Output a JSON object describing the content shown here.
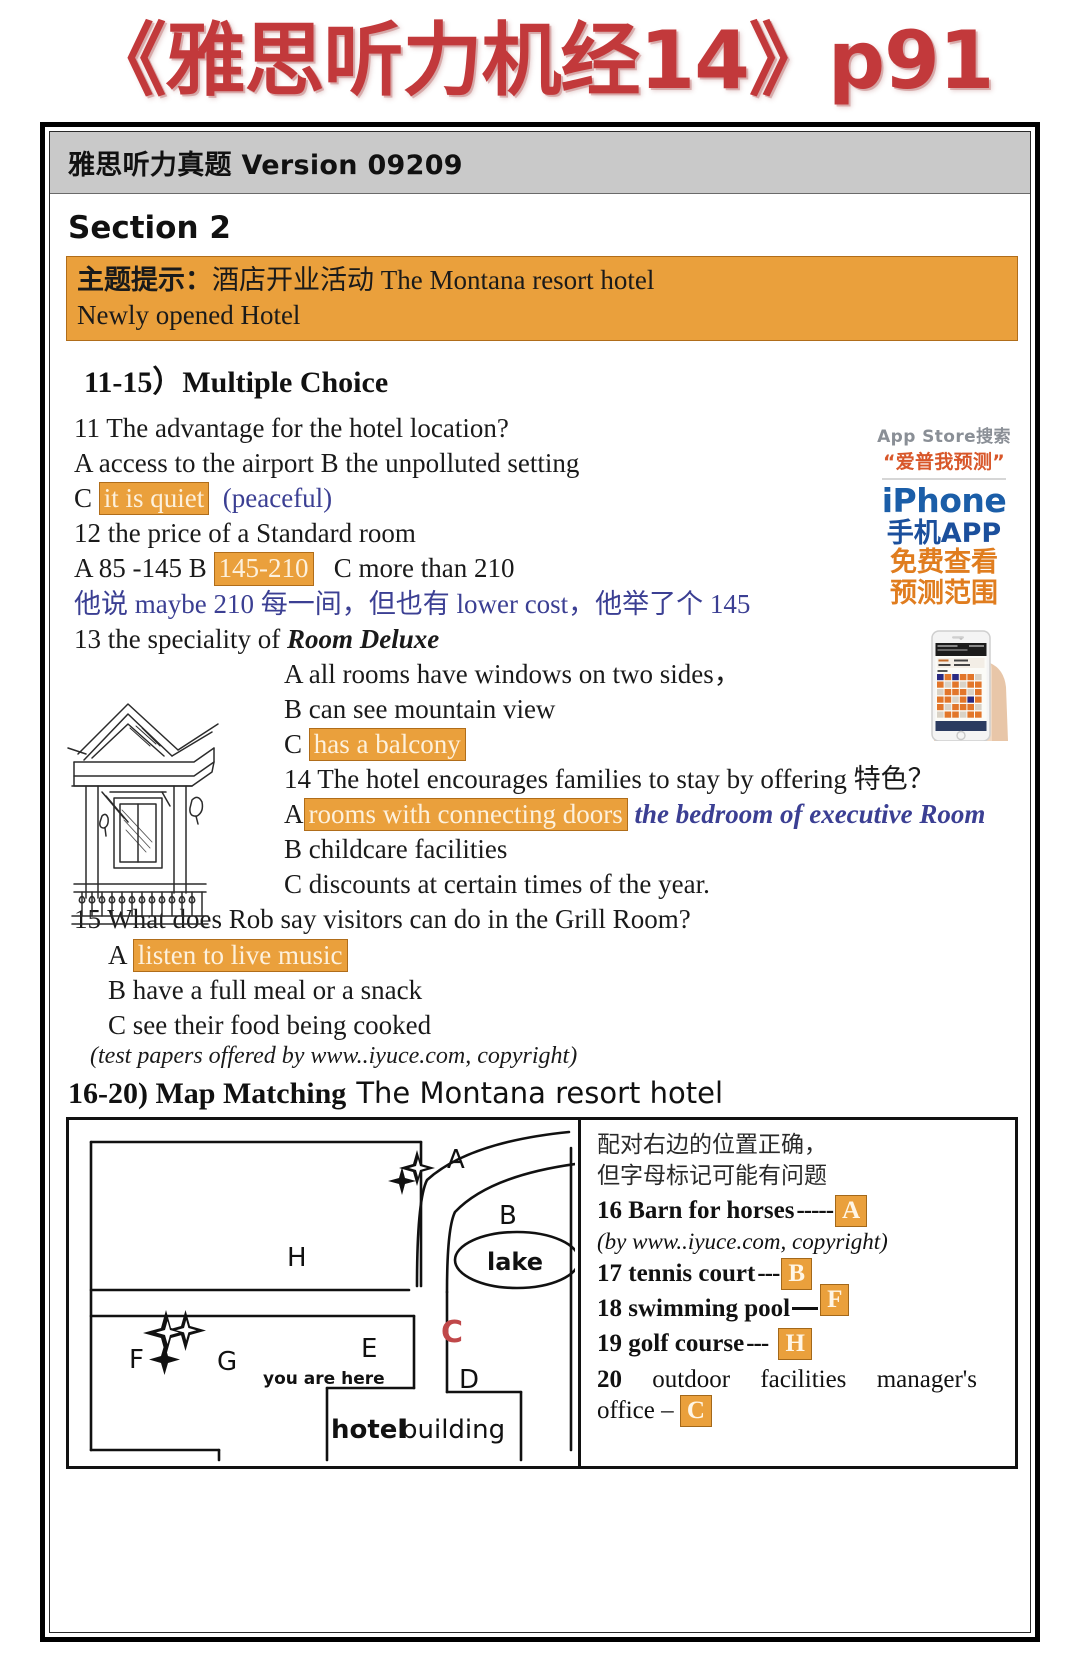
{
  "banner": {
    "title": "《雅思听力机经14》p91"
  },
  "version_bar": {
    "text": "雅思听力真题 Version 09209"
  },
  "section": {
    "title": "Section 2"
  },
  "topic_prompt": {
    "label": "主题提示：",
    "line1_rest": "酒店开业活动 The Montana resort hotel",
    "line2": "Newly opened Hotel"
  },
  "multiple_choice": {
    "heading": "11-15）Multiple Choice",
    "q11": {
      "stem": "11 The advantage for the hotel location?",
      "options_line": "A access to the airport B the unpolluted setting",
      "c_letter": "C",
      "c_highlight": "it is quiet",
      "c_note": "(peaceful)"
    },
    "q12": {
      "stem": "12 the price of a Standard room",
      "a_text": "A 85 -145 B",
      "b_highlight": "145-210",
      "c_text": "C more than 210",
      "cn_note": "他说 maybe 210 每一间，但也有 lower cost，他举了个 145"
    },
    "q13": {
      "stem_prefix": "13 the speciality of ",
      "stem_italic": "Room Deluxe",
      "option_a": "A all rooms have windows on two sides，",
      "option_b": "B    can see mountain view",
      "c_letter": "C",
      "c_highlight": "has a balcony"
    },
    "q14": {
      "stem": "14 The hotel encourages families to stay by offering 特色？",
      "a_letter": "A",
      "a_highlight": "rooms with connecting doors",
      "a_note": "the bedroom of executive Room",
      "option_b": "B    childcare facilities",
      "option_c": "C discounts at certain times of the year."
    },
    "q15": {
      "stem": "15 What does Rob say visitors can do in the Grill Room?",
      "a_letter": "A",
      "a_highlight": "listen to live music",
      "option_b": "B have a full meal or a snack",
      "option_c": "C see their food being cooked"
    },
    "copyright": "(test papers offered by www..iyuce.com, copyright)"
  },
  "advert": {
    "line1": "App Store搜索",
    "line2": "“爱普我预测”",
    "iphone": "iPhone",
    "line4": "手机APP",
    "line5a": "免费查看",
    "line5b": "预测范围"
  },
  "map_matching": {
    "heading_bold": "16-20) Map Matching",
    "heading_sans": "The Montana resort hotel",
    "note_line1": "配对右边的位置正确，",
    "note_line2": "但字母标记可能有问题",
    "items": [
      {
        "label": "16 Barn for horses",
        "dashes": "-----",
        "answer": "A"
      },
      {
        "label": "17 tennis court",
        "dashes": "---",
        "answer": "B"
      },
      {
        "label": "18 swimming pool",
        "dashes": "solid",
        "answer": "F"
      },
      {
        "label": "19 golf course",
        "dashes": "---",
        "answer": "H"
      }
    ],
    "copyright_note": "(by www..iyuce.com, copyright)",
    "item20": {
      "number": "20",
      "w1": "outdoor",
      "w2": "facilities",
      "w3": "manager's",
      "line2_prefix": "office  –",
      "answer": "C"
    },
    "map_labels": {
      "a": "A",
      "b": "B",
      "c": "C",
      "d": "D",
      "e": "E",
      "f": "F",
      "g": "G",
      "h": "H",
      "lake": "lake",
      "you_are_here": "you are here",
      "hotel_bold": "hotel",
      "hotel_rest": " building"
    }
  },
  "colors": {
    "banner_red": "#c2393b",
    "highlight_orange": "#eaa03c",
    "annotation_blue": "#3b3f93",
    "map_c_red": "#c0484a"
  }
}
